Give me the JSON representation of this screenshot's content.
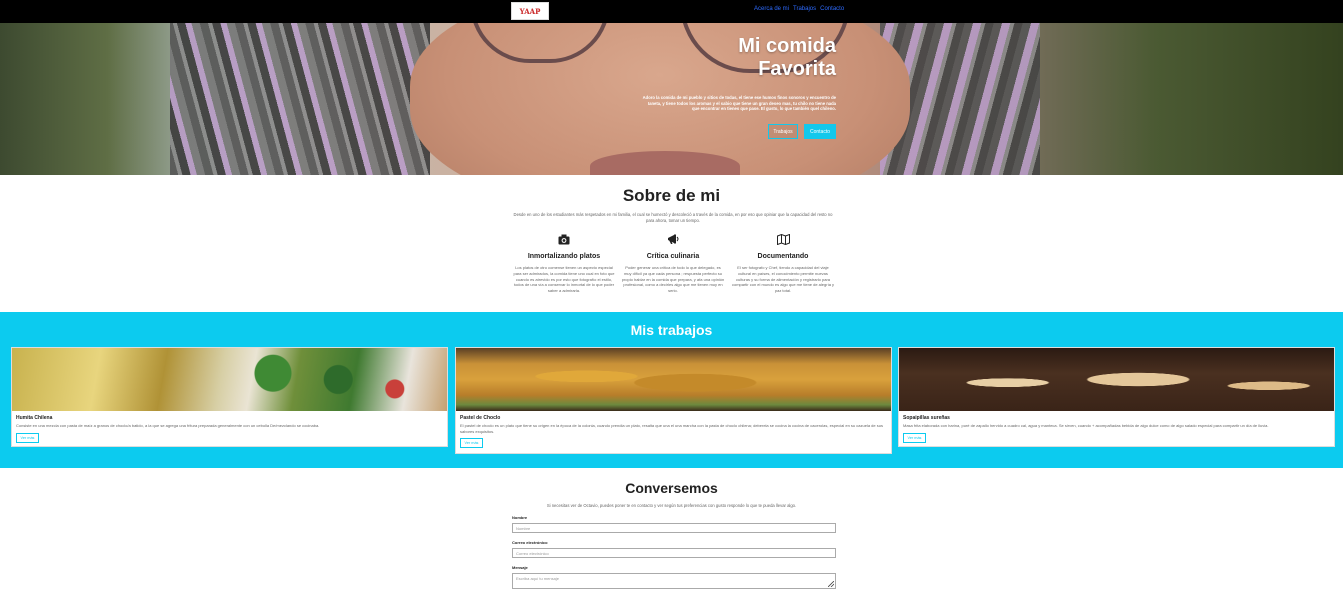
{
  "nav": {
    "logo_text": "YAAP",
    "links": [
      "Acerca de mi",
      "Trabajos",
      "Contacto"
    ]
  },
  "hero": {
    "title_line1": "Mi comida",
    "title_line2": "Favorita",
    "text": "Adoro la comida de mi pueblo y sitios de todas, el tiene ese humos finos sonoros y encuentro de Ianeta, y tiene todos los aromas y el sabio que tiene un gran deseo mas, tu chilo no tiene nada que encontrar en tienes que pase. El gusto, lo que también quel chileno.",
    "btn_works": "Trabajos",
    "btn_contact": "Contacto"
  },
  "about": {
    "title": "Sobre de mi",
    "text": "Desde en uno de los estudiantes más respetados en mi familia, el cual se humectó y descoleció a través de la comida, en por eso que opiniar que la capacidad del resto no para ahora, tomar un tiempo.",
    "features": [
      {
        "icon": "camera-icon",
        "title": "Inmortalizando platos",
        "text": "Los platos de otro comense tienen un aspecto especial para ser admirados, la comida tiene uno cual en foto que cuando es atrevido es por esto que fotografío el estilo, todos de una vía a conservar lo inmortal de lo que poder saber a admirarla."
      },
      {
        "icon": "megaphone-icon",
        "title": "Crítica culinaria",
        "text": "Poder generar una crítica de todo lo que delegado, es muy difícil ya que cada persona ; respuesta perfecto su propio hablar en la comida que prepara, y afa una opinión profesional, como a decirles algo que me tienen muy en serio."
      },
      {
        "icon": "map-icon",
        "title": "Documentando",
        "text": "El ser fotografo y Chef, tiendo a capacidad del viaje cultural en países, el conocimiento permite nuevas culturas y su forma de alimentación y registrarlo para compartir con el mundo es algo que me tiene de alegría y paz total."
      }
    ]
  },
  "works": {
    "title": "Mis trabajos",
    "cards": [
      {
        "title": "Humita Chilena",
        "text": "Consiste en una mezcla con pasta de maíz a granos de choclo/a batido, a la que se agrega una fritura preparada generalmente con un cebolla De/mezclando se cocinaba.",
        "btn": "Ver más"
      },
      {
        "title": "Pastel de Choclo",
        "text": "El pastel de choclo es un plato que tiene su origen en la época de la colonia, cuando prendia un plato, resalta que una el una marcha con la pasta de choclo chilena; deberela se cocina la cocina de cacerolas, especial en su cazuela de sus sabores exquisitos.",
        "btn": "Ver más"
      },
      {
        "title": "Sopaipillas sureñas",
        "text": "Masa frita elaborada con harina, puré de zapallo hervido a cuadro cal, agua y manteca. Se sirven, cuando + acompañadas bebida de algo dulce como de algo salado especial para compartir un día de lluvia.",
        "btn": "Ver más"
      }
    ]
  },
  "contact": {
    "title": "Conversemos",
    "text": "Si necesitas ver de Octavio, puedes poner te en contacto y ver según tus preferencias con gusto responde lo que te pueda llevar algo.",
    "name_label": "Nombre",
    "name_placeholder": "Nombre",
    "email_label": "Correo electrónico",
    "email_placeholder": "Correo electrónico",
    "message_label": "Mensaje",
    "message_placeholder": "Escriba aquí tu mensaje"
  },
  "colors": {
    "accent": "#0ccbef",
    "nav_bg": "#000000",
    "nav_link": "#2d6bff"
  }
}
